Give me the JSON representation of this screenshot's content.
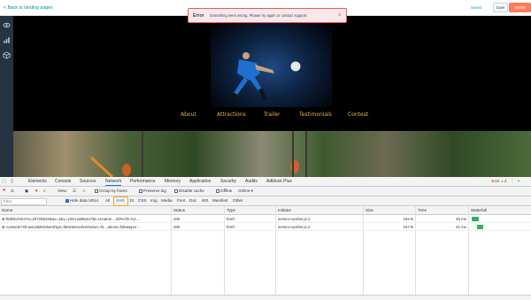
{
  "header": {
    "back_label": "< Back to landing pages",
    "saved_label": "Saved",
    "save_label": "Save",
    "update_label": "Update"
  },
  "error": {
    "title": "Error",
    "message": "Something went wrong. Please try again or contact support.",
    "close": "×"
  },
  "sidebar": {
    "icons": [
      "eye-icon",
      "chart-icon",
      "box-icon"
    ]
  },
  "site_nav": [
    "About",
    "Attractions",
    "Trailer",
    "Testimonials",
    "Contest"
  ],
  "devtools": {
    "tabs": [
      "Elements",
      "Console",
      "Sources",
      "Network",
      "Performance",
      "Memory",
      "Application",
      "Security",
      "Audits",
      "Adblock Plus"
    ],
    "active_tab": "Network",
    "counts": {
      "errors": "13",
      "warnings": "2"
    },
    "toolbar": {
      "view_label": "View:",
      "group_by_frame": "Group by frame",
      "preserve_log": "Preserve log",
      "disable_cache": "Disable cache",
      "offline": "Offline",
      "online": "Online"
    },
    "filterbar": {
      "filter_placeholder": "Filter",
      "hide_data_urls": "Hide data URLs",
      "types": [
        "All",
        "XHR",
        "JS",
        "CSS",
        "Img",
        "Media",
        "Font",
        "Doc",
        "WS",
        "Manifest",
        "Other"
      ]
    },
    "columns": [
      "Name",
      "Status",
      "Type",
      "Initiator",
      "Size",
      "Time",
      "Waterfall"
    ],
    "rows": [
      {
        "name": "f8d0b1f4047a=20725633&ax=1&v=1044.a6554e7&t=Umame…2i0%7D,%2…",
        "status": "200",
        "type": "fetch",
        "initiator": "service-worker.js:1",
        "size": "182 B",
        "time": "45 ms",
        "waterfall": 0.06
      },
      {
        "name": "contacts?showListMemberships=false&resolveOwner=fa…ations=false&por…",
        "status": "200",
        "type": "fetch",
        "initiator": "service-worker.js:1",
        "size": "167 B",
        "time": "41 ms",
        "waterfall": 0.055
      }
    ]
  }
}
